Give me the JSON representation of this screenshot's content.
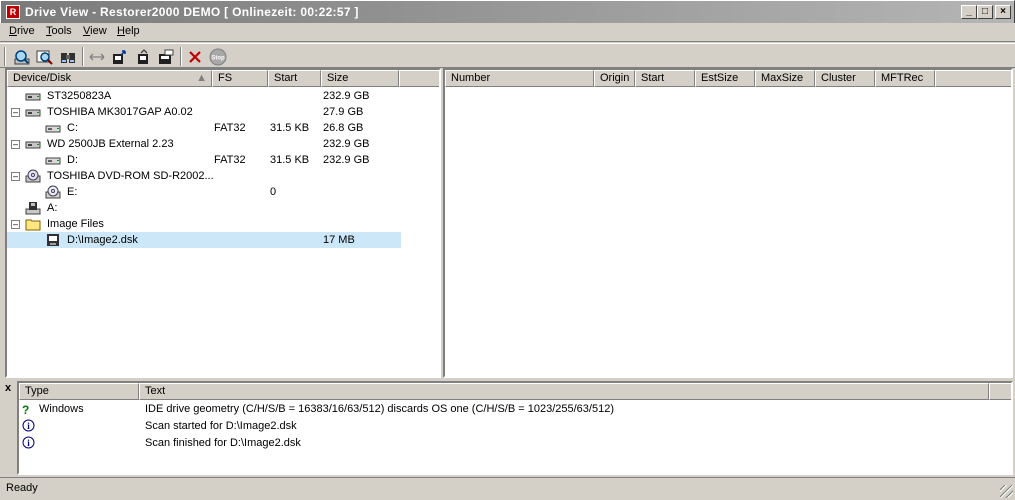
{
  "window": {
    "title": "Drive View - Restorer2000 DEMO [ Onlinezeit: 00:22:57 ]",
    "controls": [
      "minimize",
      "maximize",
      "close"
    ]
  },
  "menu": [
    {
      "label": "Drive",
      "accel": "D"
    },
    {
      "label": "Tools",
      "accel": "T"
    },
    {
      "label": "View",
      "accel": "V"
    },
    {
      "label": "Help",
      "accel": "H"
    }
  ],
  "toolbar": {
    "icons": [
      "scan-drive-icon",
      "scan-options-icon",
      "find-files-icon",
      "link-icon",
      "open-image-icon",
      "copy-icon",
      "export-icon",
      "delete-icon",
      "stop-icon"
    ],
    "stop_label": "Stop"
  },
  "left_pane": {
    "columns": [
      "Device/Disk",
      "FS",
      "Start",
      "Size"
    ],
    "rows": [
      {
        "label": "ST3250823A",
        "fs": "",
        "start": "",
        "size": "232.9 GB",
        "icon": "hard-disk-icon",
        "level": 0
      },
      {
        "label": "TOSHIBA MK3017GAP A0.02",
        "fs": "",
        "start": "",
        "size": "27.9 GB",
        "icon": "hard-disk-icon",
        "level": 0,
        "expanded": true
      },
      {
        "label": "C:",
        "fs": "FAT32",
        "start": "31.5 KB",
        "size": "26.8 GB",
        "icon": "partition-icon",
        "level": 1
      },
      {
        "label": "WD 2500JB External 2.23",
        "fs": "",
        "start": "",
        "size": "232.9 GB",
        "icon": "hard-disk-icon",
        "level": 0,
        "expanded": true
      },
      {
        "label": "D:",
        "fs": "FAT32",
        "start": "31.5 KB",
        "size": "232.9 GB",
        "icon": "partition-icon",
        "level": 1
      },
      {
        "label": "TOSHIBA DVD-ROM SD-R2002...",
        "fs": "",
        "start": "",
        "size": "",
        "icon": "cdrom-icon",
        "level": 0,
        "expanded": true
      },
      {
        "label": "E:",
        "fs": "",
        "start": "0",
        "size": "",
        "icon": "cd-partition-icon",
        "level": 1
      },
      {
        "label": "A:",
        "fs": "",
        "start": "",
        "size": "",
        "icon": "floppy-icon",
        "level": 0
      },
      {
        "label": "Image Files",
        "fs": "",
        "start": "",
        "size": "",
        "icon": "folder-icon",
        "level": 0,
        "expanded": true
      },
      {
        "label": "D:\\Image2.dsk",
        "fs": "",
        "start": "",
        "size": "17 MB",
        "icon": "image-file-icon",
        "level": 1,
        "selected": true
      }
    ]
  },
  "right_pane": {
    "columns": [
      "Number",
      "Origin",
      "Start",
      "EstSize",
      "MaxSize",
      "Cluster",
      "MFTRec"
    ]
  },
  "log": {
    "close_glyph": "x",
    "columns": [
      "Type",
      "Text"
    ],
    "rows": [
      {
        "type": "Windows",
        "icon": "question-icon",
        "text": "IDE drive geometry (C/H/S/B = 16383/16/63/512) discards OS one (C/H/S/B = 1023/255/63/512)"
      },
      {
        "type": "",
        "icon": "info-icon",
        "text": "Scan started for D:\\Image2.dsk"
      },
      {
        "type": "",
        "icon": "info-icon",
        "text": "Scan finished for D:\\Image2.dsk"
      }
    ]
  },
  "status": {
    "text": "Ready"
  }
}
